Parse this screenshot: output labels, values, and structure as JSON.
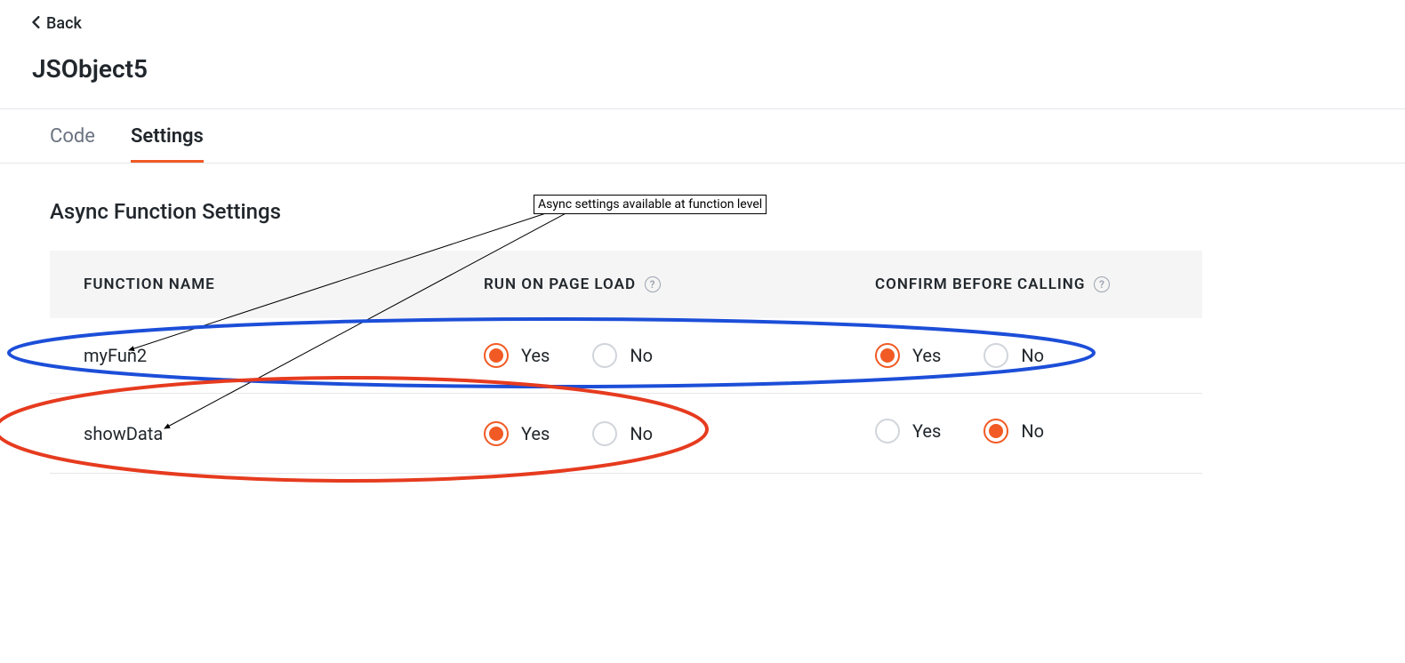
{
  "nav": {
    "back": "Back"
  },
  "page": {
    "title": "JSObject5"
  },
  "tabs": {
    "code": "Code",
    "settings": "Settings"
  },
  "section": {
    "heading": "Async Function Settings"
  },
  "columns": {
    "fn": "FUNCTION NAME",
    "run": "RUN ON PAGE LOAD",
    "confirm": "CONFIRM BEFORE CALLING"
  },
  "labels": {
    "yes": "Yes",
    "no": "No"
  },
  "rows": [
    {
      "name": "myFun2",
      "run_on_load": "Yes",
      "confirm_before": "Yes"
    },
    {
      "name": "showData",
      "run_on_load": "Yes",
      "confirm_before": "No"
    }
  ],
  "annotation": {
    "text": "Async settings available at function level"
  },
  "colors": {
    "accent": "#f15a24",
    "blue": "#1c4ed8",
    "red": "#e63b1f"
  }
}
